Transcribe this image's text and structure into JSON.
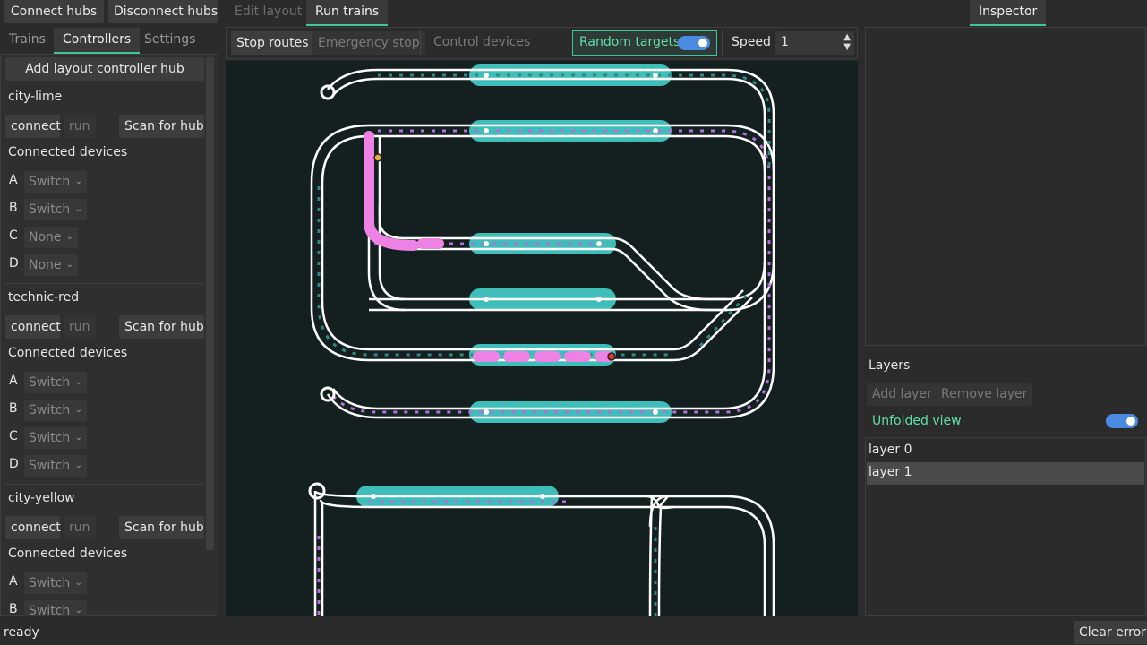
{
  "toolbar": {
    "connect_hubs": "Connect hubs",
    "disconnect_hubs": "Disconnect hubs"
  },
  "main_tabs": [
    "Edit layout",
    "Run trains"
  ],
  "left_tabs": [
    "Trains",
    "Controllers",
    "Settings"
  ],
  "controllers": {
    "add_label": "Add layout controller hub",
    "connect_label": "connect",
    "run_label": "run",
    "scan_label": "Scan for hub",
    "devices_label": "Connected devices",
    "hubs": [
      {
        "name": "city-lime",
        "ports": [
          {
            "port": "A",
            "value": "Switch"
          },
          {
            "port": "B",
            "value": "Switch"
          },
          {
            "port": "C",
            "value": "None"
          },
          {
            "port": "D",
            "value": "None"
          }
        ]
      },
      {
        "name": "technic-red",
        "ports": [
          {
            "port": "A",
            "value": "Switch"
          },
          {
            "port": "B",
            "value": "Switch"
          },
          {
            "port": "C",
            "value": "Switch"
          },
          {
            "port": "D",
            "value": "Switch"
          }
        ]
      },
      {
        "name": "city-yellow",
        "ports": [
          {
            "port": "A",
            "value": "Switch"
          },
          {
            "port": "B",
            "value": "Switch"
          }
        ]
      }
    ]
  },
  "run_bar": {
    "stop_routes": "Stop routes",
    "emergency_stop": "Emergency stop",
    "control_devices": "Control devices",
    "random_targets": "Random targets",
    "speed_label": "Speed",
    "speed_value": "1"
  },
  "inspector": {
    "tab": "Inspector"
  },
  "layers": {
    "title": "Layers",
    "add": "Add layer",
    "remove": "Remove layer",
    "unfolded_view": "Unfolded view",
    "items": [
      "layer 0",
      "layer 1"
    ],
    "selected": "layer 1"
  },
  "status": {
    "text": "ready",
    "clear_error": "Clear error"
  },
  "colors": {
    "accent": "#3fc6a0",
    "platform": "#3fbdb8",
    "train": "#ee82e4",
    "route_dots": "#b46ee0",
    "toggle": "#4a8ae0"
  }
}
